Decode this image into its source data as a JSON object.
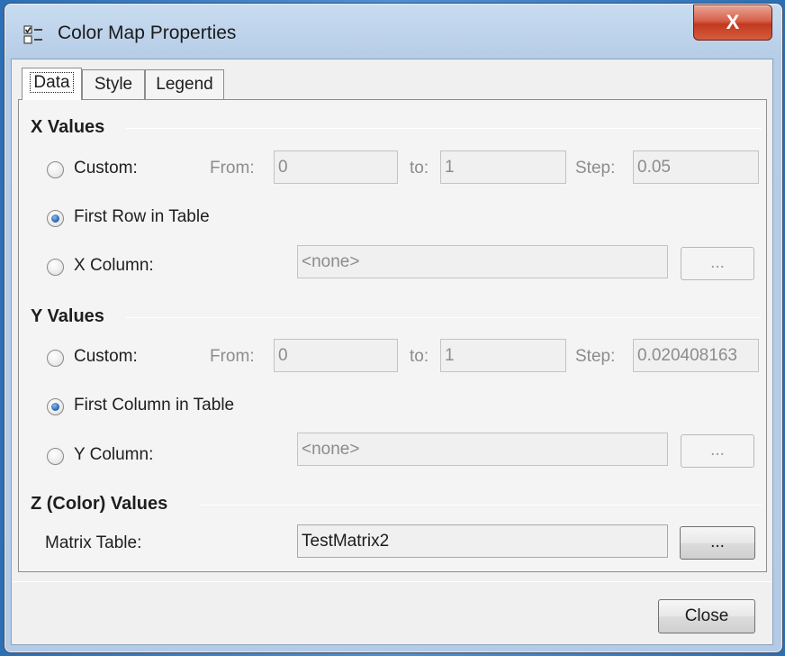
{
  "window": {
    "title": "Color Map Properties",
    "close_glyph": "X",
    "icon": "properties-icon"
  },
  "tabs": [
    {
      "label": "Data",
      "active": true
    },
    {
      "label": "Style",
      "active": false
    },
    {
      "label": "Legend",
      "active": false
    }
  ],
  "x_values": {
    "title": "X Values",
    "custom_label": "Custom:",
    "from_label": "From:",
    "from_value": "0",
    "to_label": "to:",
    "to_value": "1",
    "step_label": "Step:",
    "step_value": "0.05",
    "first_row_label": "First Row in Table",
    "column_label": "X Column:",
    "column_value": "<none>",
    "browse_label": "..."
  },
  "y_values": {
    "title": "Y Values",
    "custom_label": "Custom:",
    "from_label": "From:",
    "from_value": "0",
    "to_label": "to:",
    "to_value": "1",
    "step_label": "Step:",
    "step_value": "0.020408163",
    "first_column_label": "First Column in Table",
    "column_label": "Y Column:",
    "column_value": "<none>",
    "browse_label": "..."
  },
  "z_values": {
    "title": "Z (Color) Values",
    "matrix_label": "Matrix Table:",
    "matrix_value": "TestMatrix2",
    "browse_label": "..."
  },
  "footer": {
    "close_label": "Close"
  },
  "colors": {
    "close_button_red": "#c2391f",
    "radio_selected": "#2e6bb8",
    "desktop_blue": "#2d6fb5"
  }
}
